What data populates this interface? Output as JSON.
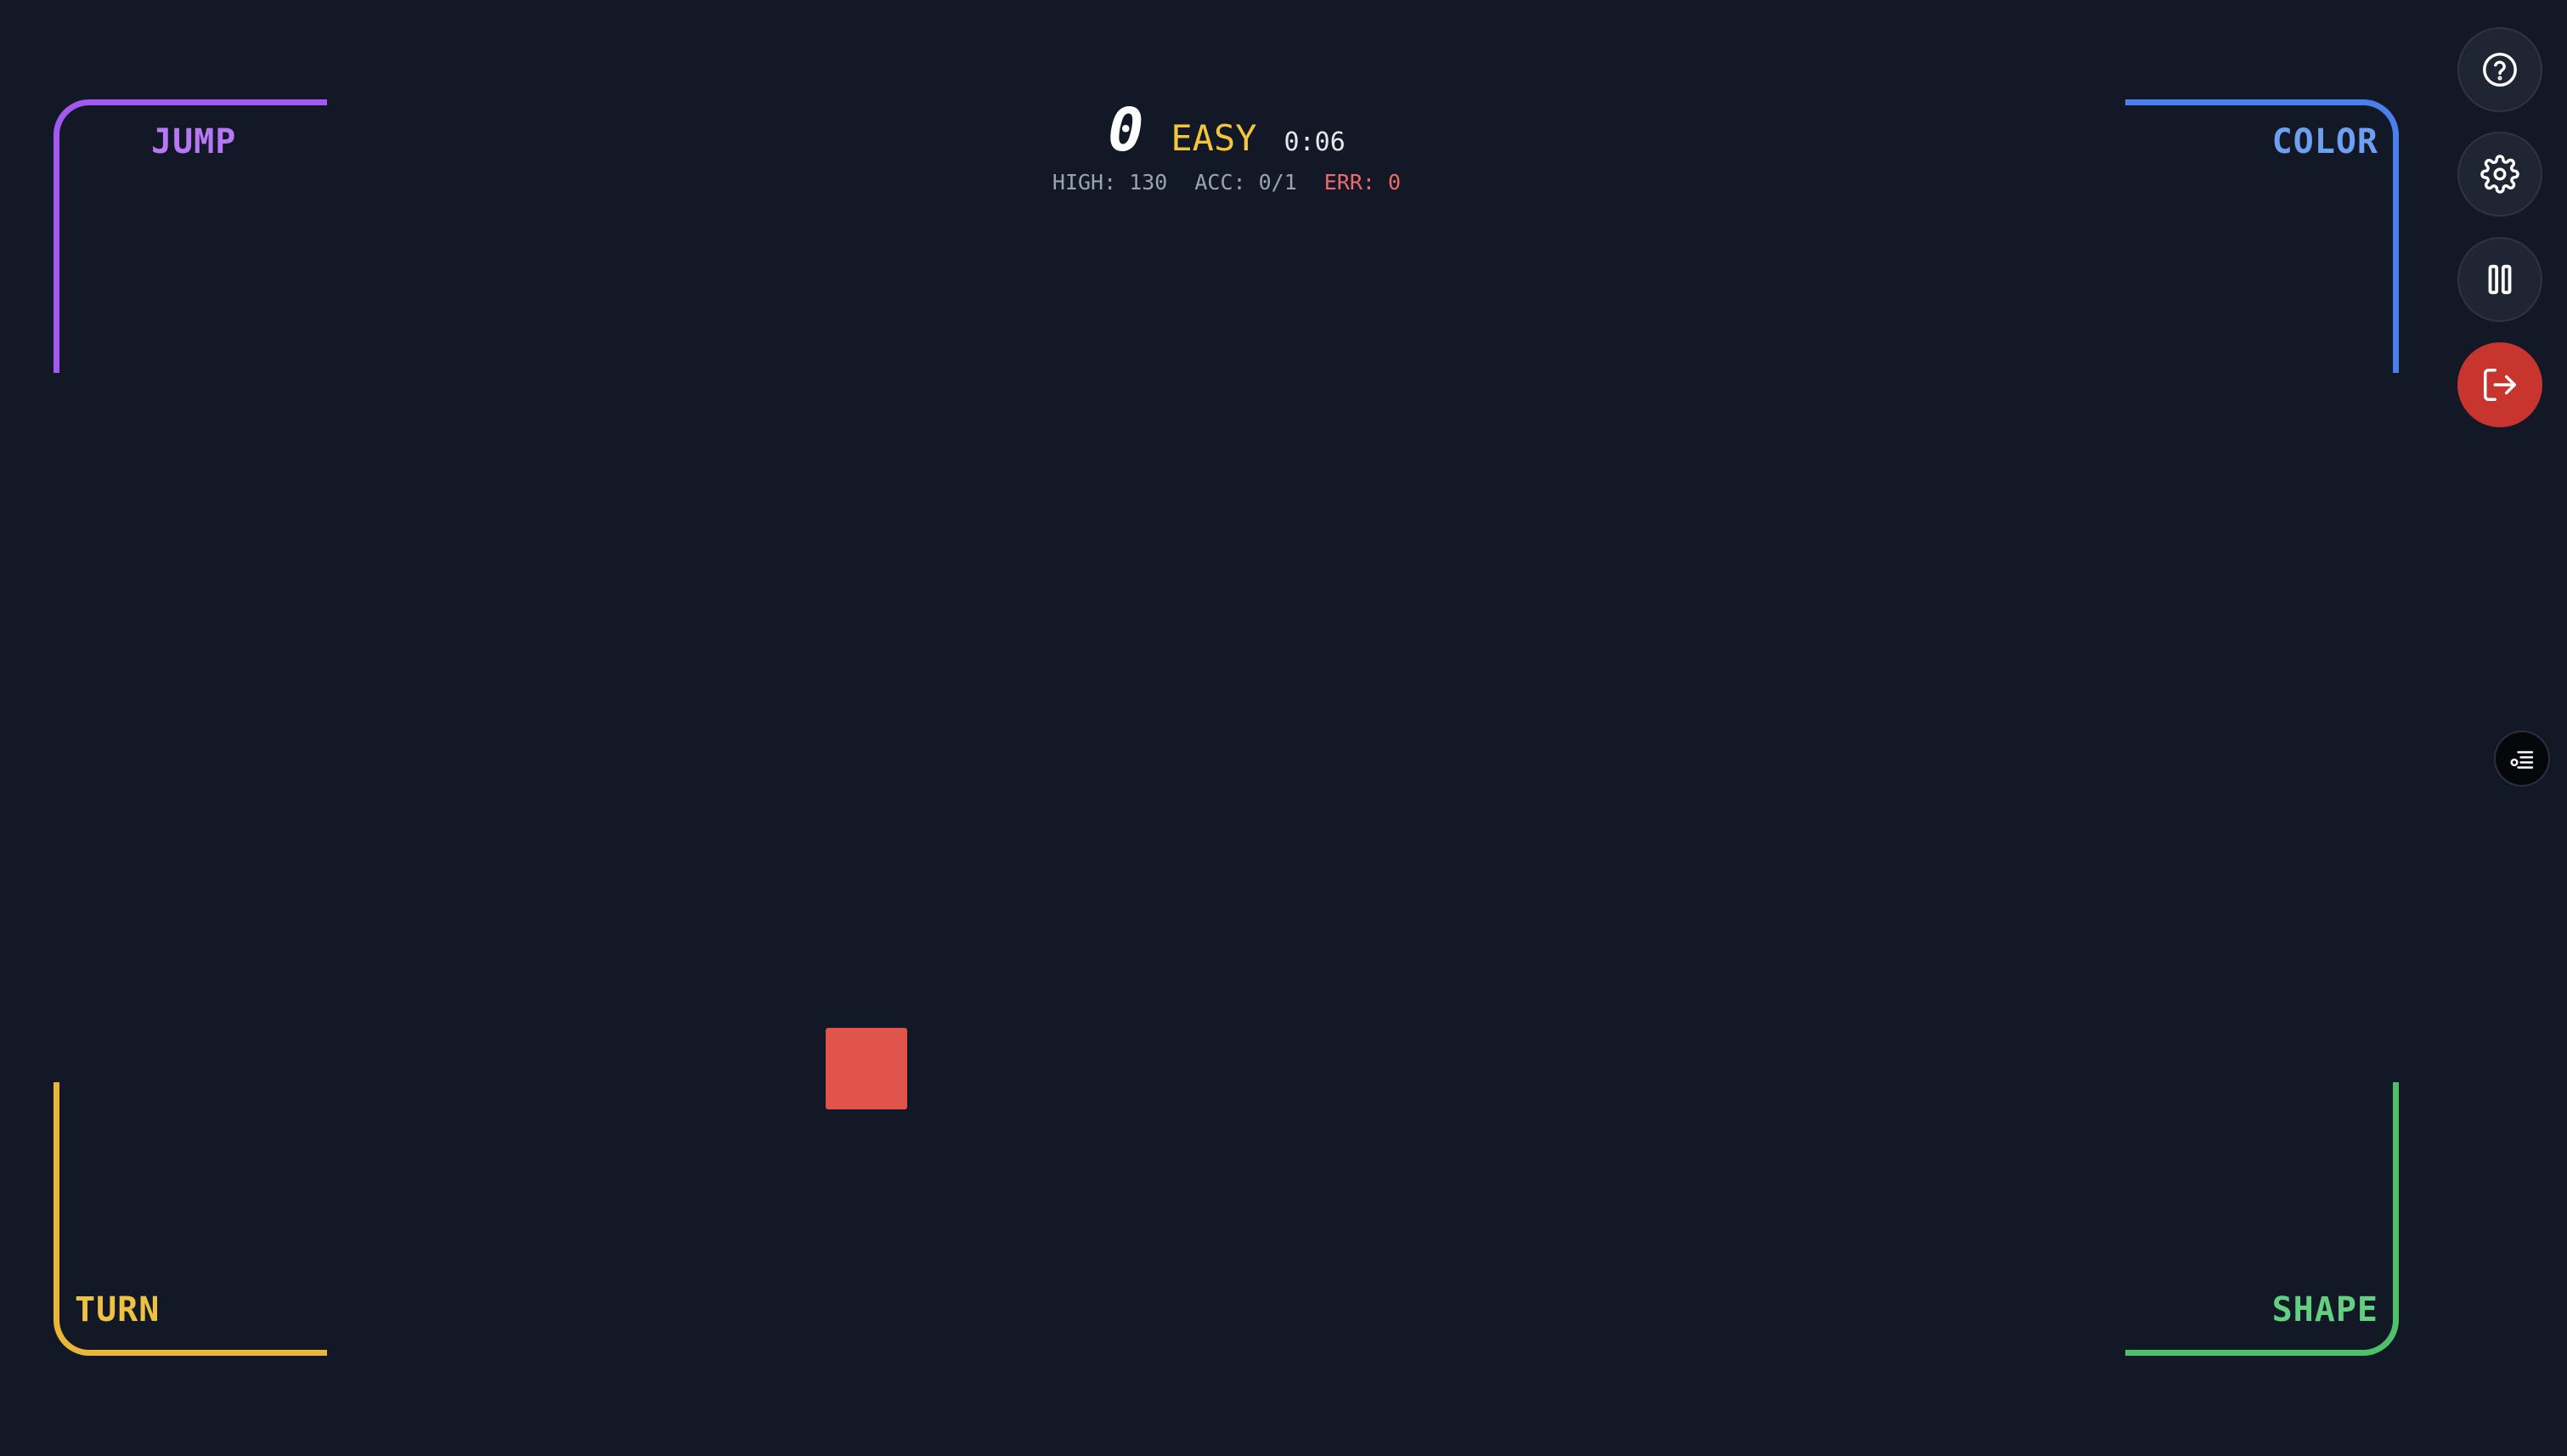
{
  "hud": {
    "score": "0",
    "difficulty": "EASY",
    "timer": "0:06",
    "high": "HIGH: 130",
    "acc": "ACC: 0/1",
    "err": "ERR: 0"
  },
  "corners": {
    "top_left": "JUMP",
    "top_right": "COLOR",
    "bottom_left": "TURN",
    "bottom_right": "SHAPE"
  },
  "controls": {
    "help_icon": "question-circle-icon",
    "settings_icon": "gear-icon",
    "pause_icon": "pause-icon",
    "exit_icon": "exit-icon",
    "toggle_icon": "list-settings-icon"
  },
  "colors": {
    "background": "#131826",
    "jump": "#a259f0",
    "color": "#4b7fec",
    "turn": "#eab637",
    "shape": "#4fbf6a",
    "player": "#e0544c",
    "exit_button": "#c8352e",
    "difficulty": "#f2c53d",
    "error": "#f06a6a"
  }
}
